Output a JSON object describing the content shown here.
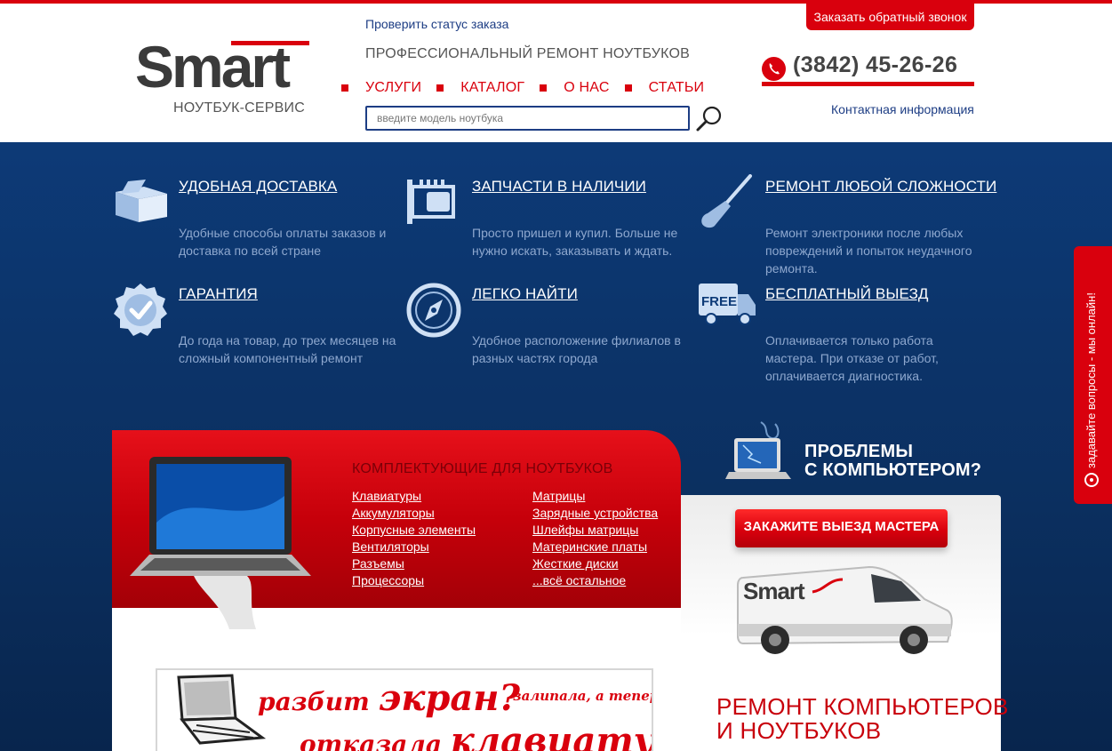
{
  "colors": {
    "brand_red": "#d9000d",
    "navy": "#0c3468",
    "link_blue": "#1d3d84"
  },
  "header": {
    "logo_text": "Smart",
    "logo_sub": "НОУТБУК-СЕРВИС",
    "status_link": "Проверить статус заказа",
    "tagline": "ПРОФЕССИОНАЛЬНЫЙ РЕМОНТ НОУТБУКОВ",
    "nav": [
      "УСЛУГИ",
      "КАТАЛОГ",
      "О НАС",
      "СТАТЬИ"
    ],
    "search_placeholder": "введите модель ноутбука",
    "callback_button": "Заказать обратный звонок",
    "phone": "(3842) 45-26-26",
    "contacts_link": "Контактная информация"
  },
  "features": [
    {
      "icon": "box-icon",
      "title": "УДОБНАЯ ДОСТАВКА",
      "text": "Удобные способы оплаты заказов и доставка по всей стране"
    },
    {
      "icon": "chip-icon",
      "title": "ЗАПЧАСТИ В НАЛИЧИИ",
      "text": "Просто пришел и купил. Больше не нужно искать, заказывать и ждать."
    },
    {
      "icon": "screwdriver-icon",
      "title": "РЕМОНТ ЛЮБОЙ СЛОЖНОСТИ",
      "text": "Ремонт электроники после любых повреждений и попыток неудачного ремонта."
    },
    {
      "icon": "guarantee-badge-icon",
      "title": "ГАРАНТИЯ",
      "text": "До года на товар, до трех месяцев на сложный компонентный ремонт"
    },
    {
      "icon": "compass-icon",
      "title": "ЛЕГКО НАЙТИ",
      "text": "Удобное расположение филиалов в разных частях города"
    },
    {
      "icon": "free-truck-icon",
      "title": "БЕСПЛАТНЫЙ ВЫЕЗД",
      "text": "Оплачивается только работа мастера. При отказе от работ, оплачивается диагностика."
    }
  ],
  "truck_label": "FREE",
  "promo": {
    "title": "КОМПЛЕКТУЮЩИЕ ДЛЯ НОУТБУКОВ",
    "links_left": [
      "Клавиатуры",
      "Аккумуляторы",
      "Корпусные элементы",
      "Вентиляторы",
      "Разъемы",
      "Процессоры"
    ],
    "links_right": [
      "Матрицы",
      "Зарядные устройства",
      "Шлейфы матрицы",
      "Материнские платы",
      "Жесткие диски",
      "...всё остальное"
    ]
  },
  "banner": {
    "line1_small": "разбит",
    "line1_big": "экран?",
    "side": "залипала, а теперь",
    "line2_small": "отказала",
    "line2_big": "клавиатура?"
  },
  "right": {
    "problem_line1": "ПРОБЛЕМЫ",
    "problem_line2": "С КОМПЬЮТЕРОМ?",
    "order_button": "ЗАКАЖИТЕ ВЫЕЗД МАСТЕРА",
    "van_logo": "Smart",
    "repair_line1": "РЕМОНТ КОМПЬЮТЕРОВ",
    "repair_line2": "И НОУТБУКОВ"
  },
  "side_tab": "задавайте вопросы - мы онлайн!"
}
